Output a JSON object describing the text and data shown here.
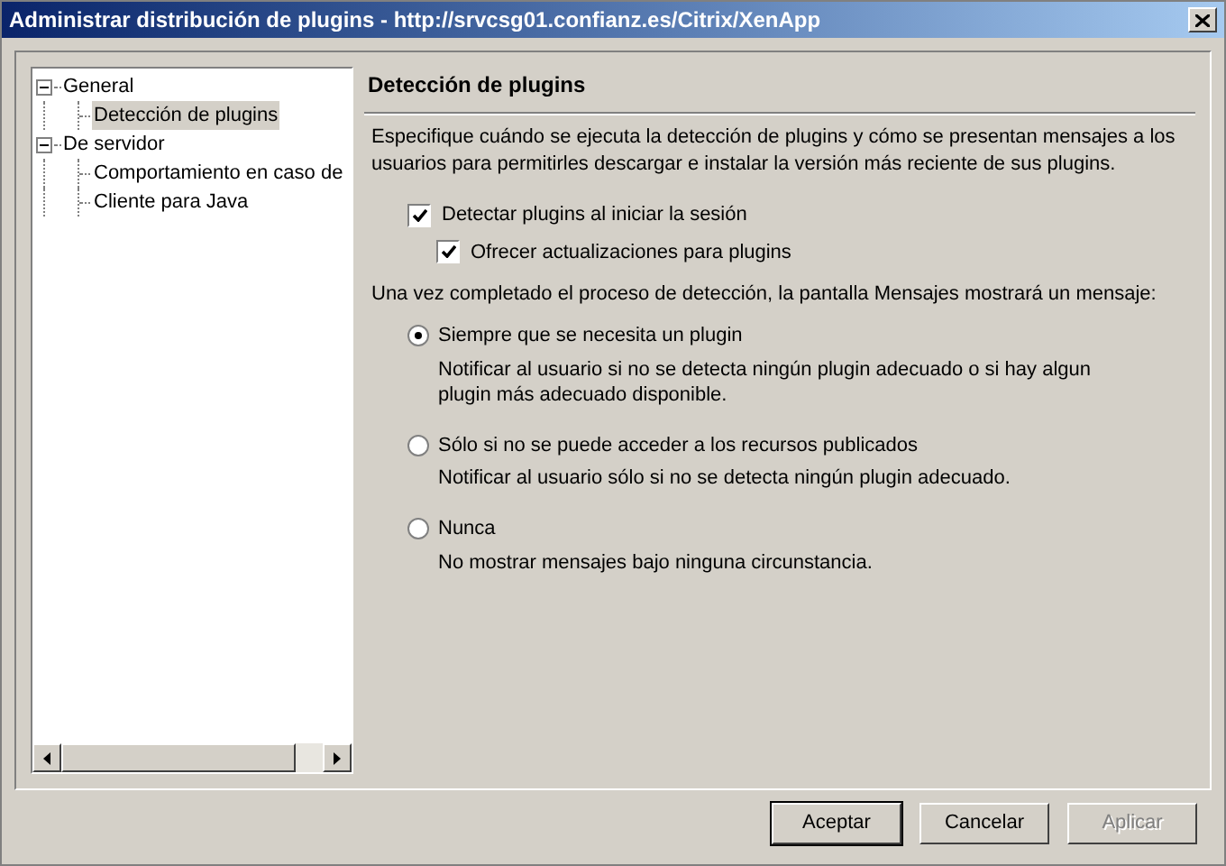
{
  "window": {
    "title": "Administrar distribución de plugins - http://srvcsg01.confianz.es/Citrix/XenApp"
  },
  "tree": {
    "items": [
      {
        "label": "General",
        "expanded": true,
        "selected": false,
        "children": [
          {
            "label": "Detección de plugins",
            "selected": true
          }
        ]
      },
      {
        "label": "De servidor",
        "expanded": true,
        "selected": false,
        "children": [
          {
            "label": "Comportamiento en caso de",
            "selected": false
          },
          {
            "label": "Cliente para Java",
            "selected": false
          }
        ]
      }
    ]
  },
  "panel": {
    "heading": "Detección de plugins",
    "description": "Especifique cuándo se ejecuta la detección de plugins y cómo se presentan mensajes a los usuarios para permitirles descargar e instalar la versión más reciente de sus plugins.",
    "checkboxes": [
      {
        "label": "Detectar plugins al iniciar la sesión",
        "checked": true,
        "children": [
          {
            "label": "Ofrecer actualizaciones para plugins",
            "checked": true
          }
        ]
      }
    ],
    "message_intro": "Una vez completado el proceso de detección, la pantalla Mensajes mostrará un mensaje:",
    "options": [
      {
        "label": "Siempre que se necesita un plugin",
        "description": "Notificar al usuario si no se detecta ningún plugin adecuado o si hay algun plugin más adecuado disponible.",
        "selected": true
      },
      {
        "label": "Sólo si no se puede acceder a los recursos publicados",
        "description": "Notificar al usuario sólo si no se detecta ningún plugin adecuado.",
        "selected": false
      },
      {
        "label": "Nunca",
        "description": "No mostrar mensajes bajo ninguna circunstancia.",
        "selected": false
      }
    ]
  },
  "buttons": [
    {
      "label": "Aceptar",
      "default": true,
      "disabled": false
    },
    {
      "label": "Cancelar",
      "default": false,
      "disabled": false
    },
    {
      "label": "Aplicar",
      "default": false,
      "disabled": true
    }
  ]
}
